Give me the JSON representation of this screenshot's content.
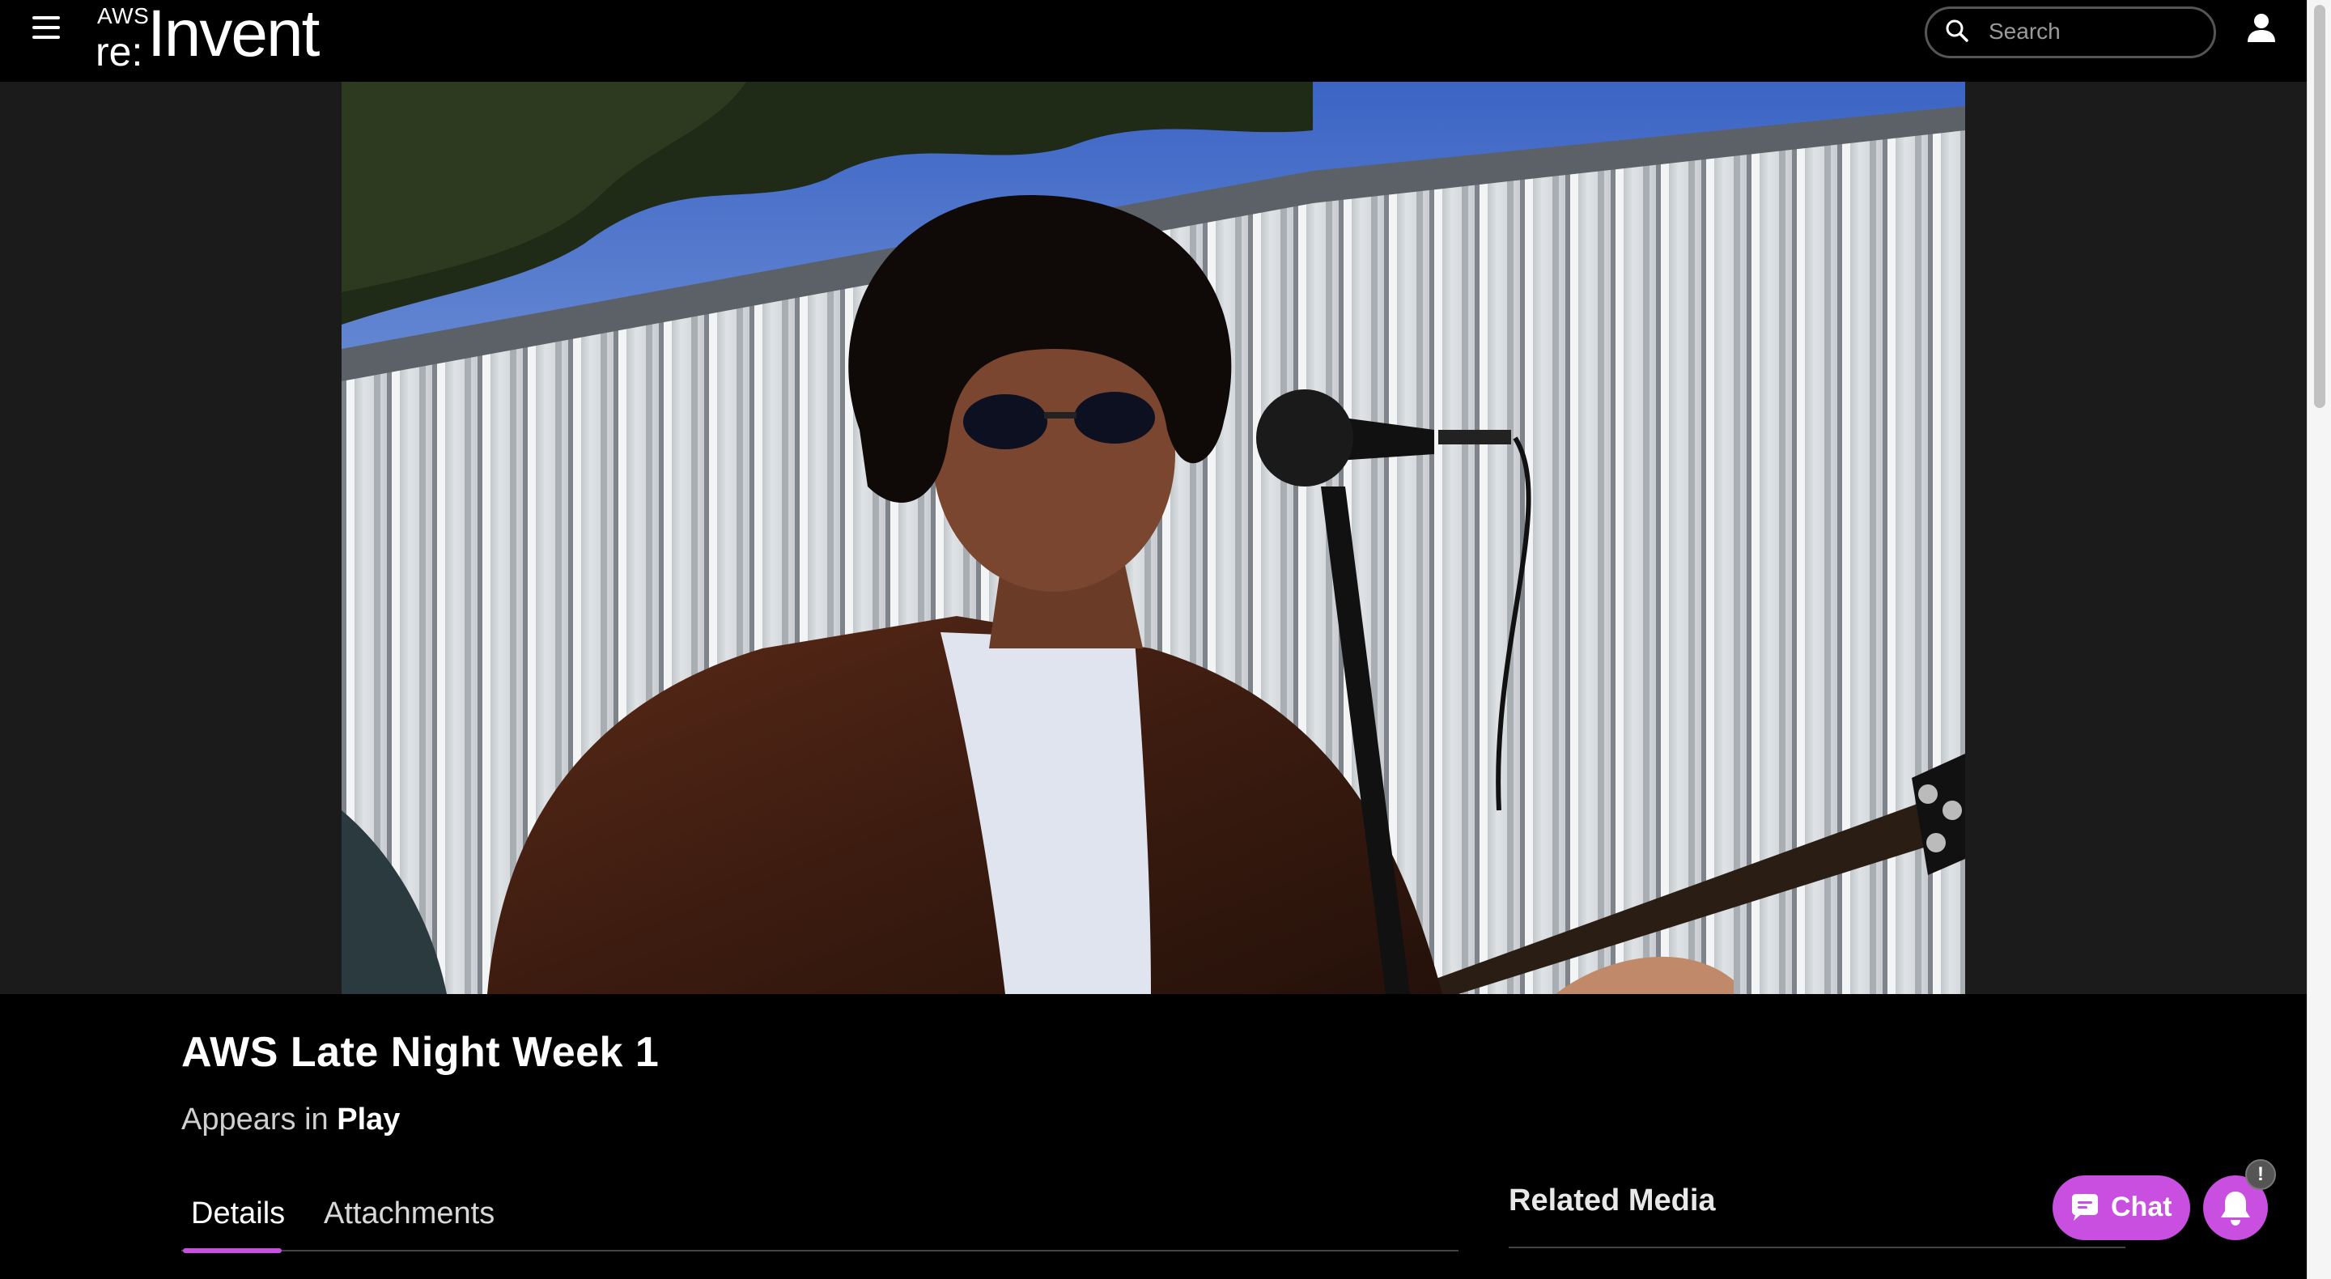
{
  "header": {
    "logo_small": "AWS",
    "logo_re": "re:",
    "logo_invent": "Invent",
    "search": {
      "placeholder": "Search"
    }
  },
  "video": {
    "description": "Performer with sunglasses and brown leather jacket singing into a microphone while playing a guitar in front of a corrugated metal wall"
  },
  "session": {
    "title": "AWS Late Night Week 1",
    "appears_prefix": "Appears in",
    "appears_track": "Play"
  },
  "tabs": [
    {
      "label": "Details",
      "active": true
    },
    {
      "label": "Attachments",
      "active": false
    }
  ],
  "related": {
    "heading": "Related Media"
  },
  "chat": {
    "label": "Chat"
  },
  "notifications": {
    "badge": "!"
  },
  "colors": {
    "accent": "#c84fe0",
    "background": "#000000",
    "video_bg": "#1b1b1b"
  },
  "icons": [
    "menu-icon",
    "search-icon",
    "user-icon",
    "chat-bubble-icon",
    "bell-icon"
  ]
}
